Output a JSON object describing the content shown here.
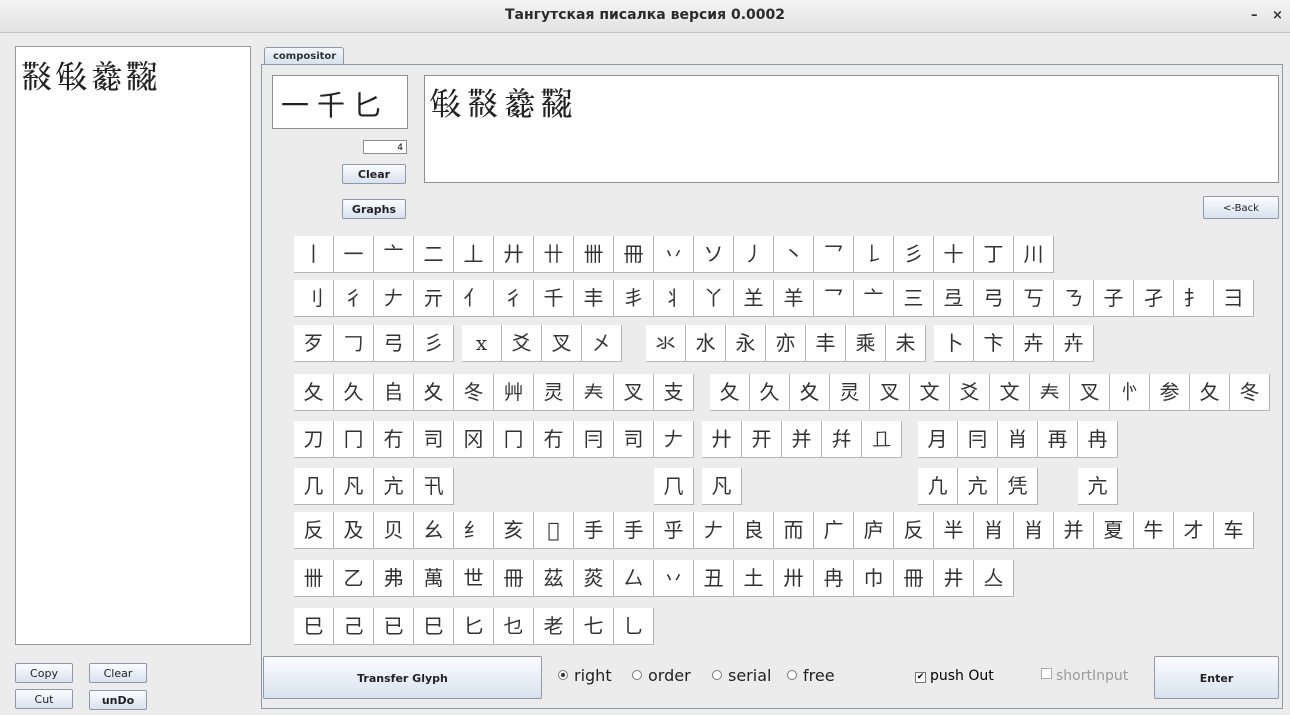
{
  "window": {
    "title": "Тангутская писалка версия 0.0002",
    "minimize_glyph": "–",
    "close_glyph": "×"
  },
  "output_text": "𘜶𘓐𘗇𘜺",
  "side_buttons": {
    "copy": "Copy",
    "clear": "Clear",
    "cut": "Cut",
    "undo": "unDo"
  },
  "tab_label": "compositor",
  "components_text": "一千匕",
  "counter_value": "4",
  "compositor_clear": "Clear",
  "graphs_label": "Graphs",
  "candidates_text": "𘓐𘜶𘗇𘜺",
  "back_label": "<-Back",
  "component_keys": [
    [
      "丨",
      "一",
      "亠",
      "二",
      "丄",
      "廾",
      "卄",
      "卌",
      "冊",
      "丷",
      "ソ",
      "丿",
      "丶",
      "乛",
      "𠄌",
      "彡",
      "十",
      "丁",
      "川"
    ],
    [
      "刂",
      "彳",
      "𠂇",
      "亓",
      "亻",
      "彳",
      "千",
      "丰",
      "丯",
      "丬",
      "丫",
      "𦍌",
      "羊",
      "乛",
      "亠",
      "三",
      "弖",
      "弓",
      "丂",
      "ㄋ",
      "子",
      "孑",
      "扌",
      "彐"
    ],
    [
      "歹",
      "𠃌",
      "弓",
      "彡",
      "x",
      "爻",
      "叉",
      "㐅",
      "氺",
      "水",
      "永",
      "亦",
      "丰",
      "乘",
      "未",
      "卜",
      "卞",
      "卉",
      "𠦄"
    ],
    [
      "夂",
      "久",
      "𠂤",
      "夊",
      "冬",
      "艸",
      "灵",
      "𡗗",
      "叉",
      "支",
      "夂",
      "久",
      "夊",
      "灵",
      "叉",
      "文",
      "爻",
      "文",
      "𡗗",
      "叉",
      "㣺",
      "参",
      "夂",
      "冬"
    ],
    [
      "刀",
      "冂",
      "冇",
      "司",
      "冈",
      "冂",
      "冇",
      "冃",
      "司",
      "𠂇",
      "廾",
      "开",
      "并",
      "幷",
      "𠀃",
      "月",
      "冃",
      "肖",
      "再",
      "冉"
    ],
    [
      "几",
      "凡",
      "亢",
      "卂",
      "𠘨",
      "凡",
      "凢",
      "亢",
      "凭",
      "亢"
    ],
    [
      "反",
      "及",
      "贝",
      "幺",
      "纟",
      "亥",
      "𠅆",
      "手",
      "手",
      "乎",
      "𠂇",
      "良",
      "而",
      "广",
      "庐",
      "反",
      "半",
      "肖",
      "肖",
      "并",
      "夏",
      "牛",
      "才",
      "车"
    ],
    [
      "卌",
      "乙",
      "弗",
      "萬",
      "世",
      "冊",
      "茲",
      "菼",
      "厶",
      "丷",
      "丑",
      "土",
      "卅",
      "冉",
      "巾",
      "冊",
      "井",
      "亼"
    ],
    [
      "巳",
      "己",
      "已",
      "巳",
      "匕",
      "乜",
      "老",
      "七",
      "乚"
    ]
  ],
  "transfer_label": "Transfer Glyph",
  "modes": [
    "right",
    "order",
    "serial",
    "free"
  ],
  "selected_mode": "right",
  "push_out_label": "push Out",
  "push_out_checked": "✔",
  "short_input_label": "shortInput",
  "enter_label": "Enter"
}
